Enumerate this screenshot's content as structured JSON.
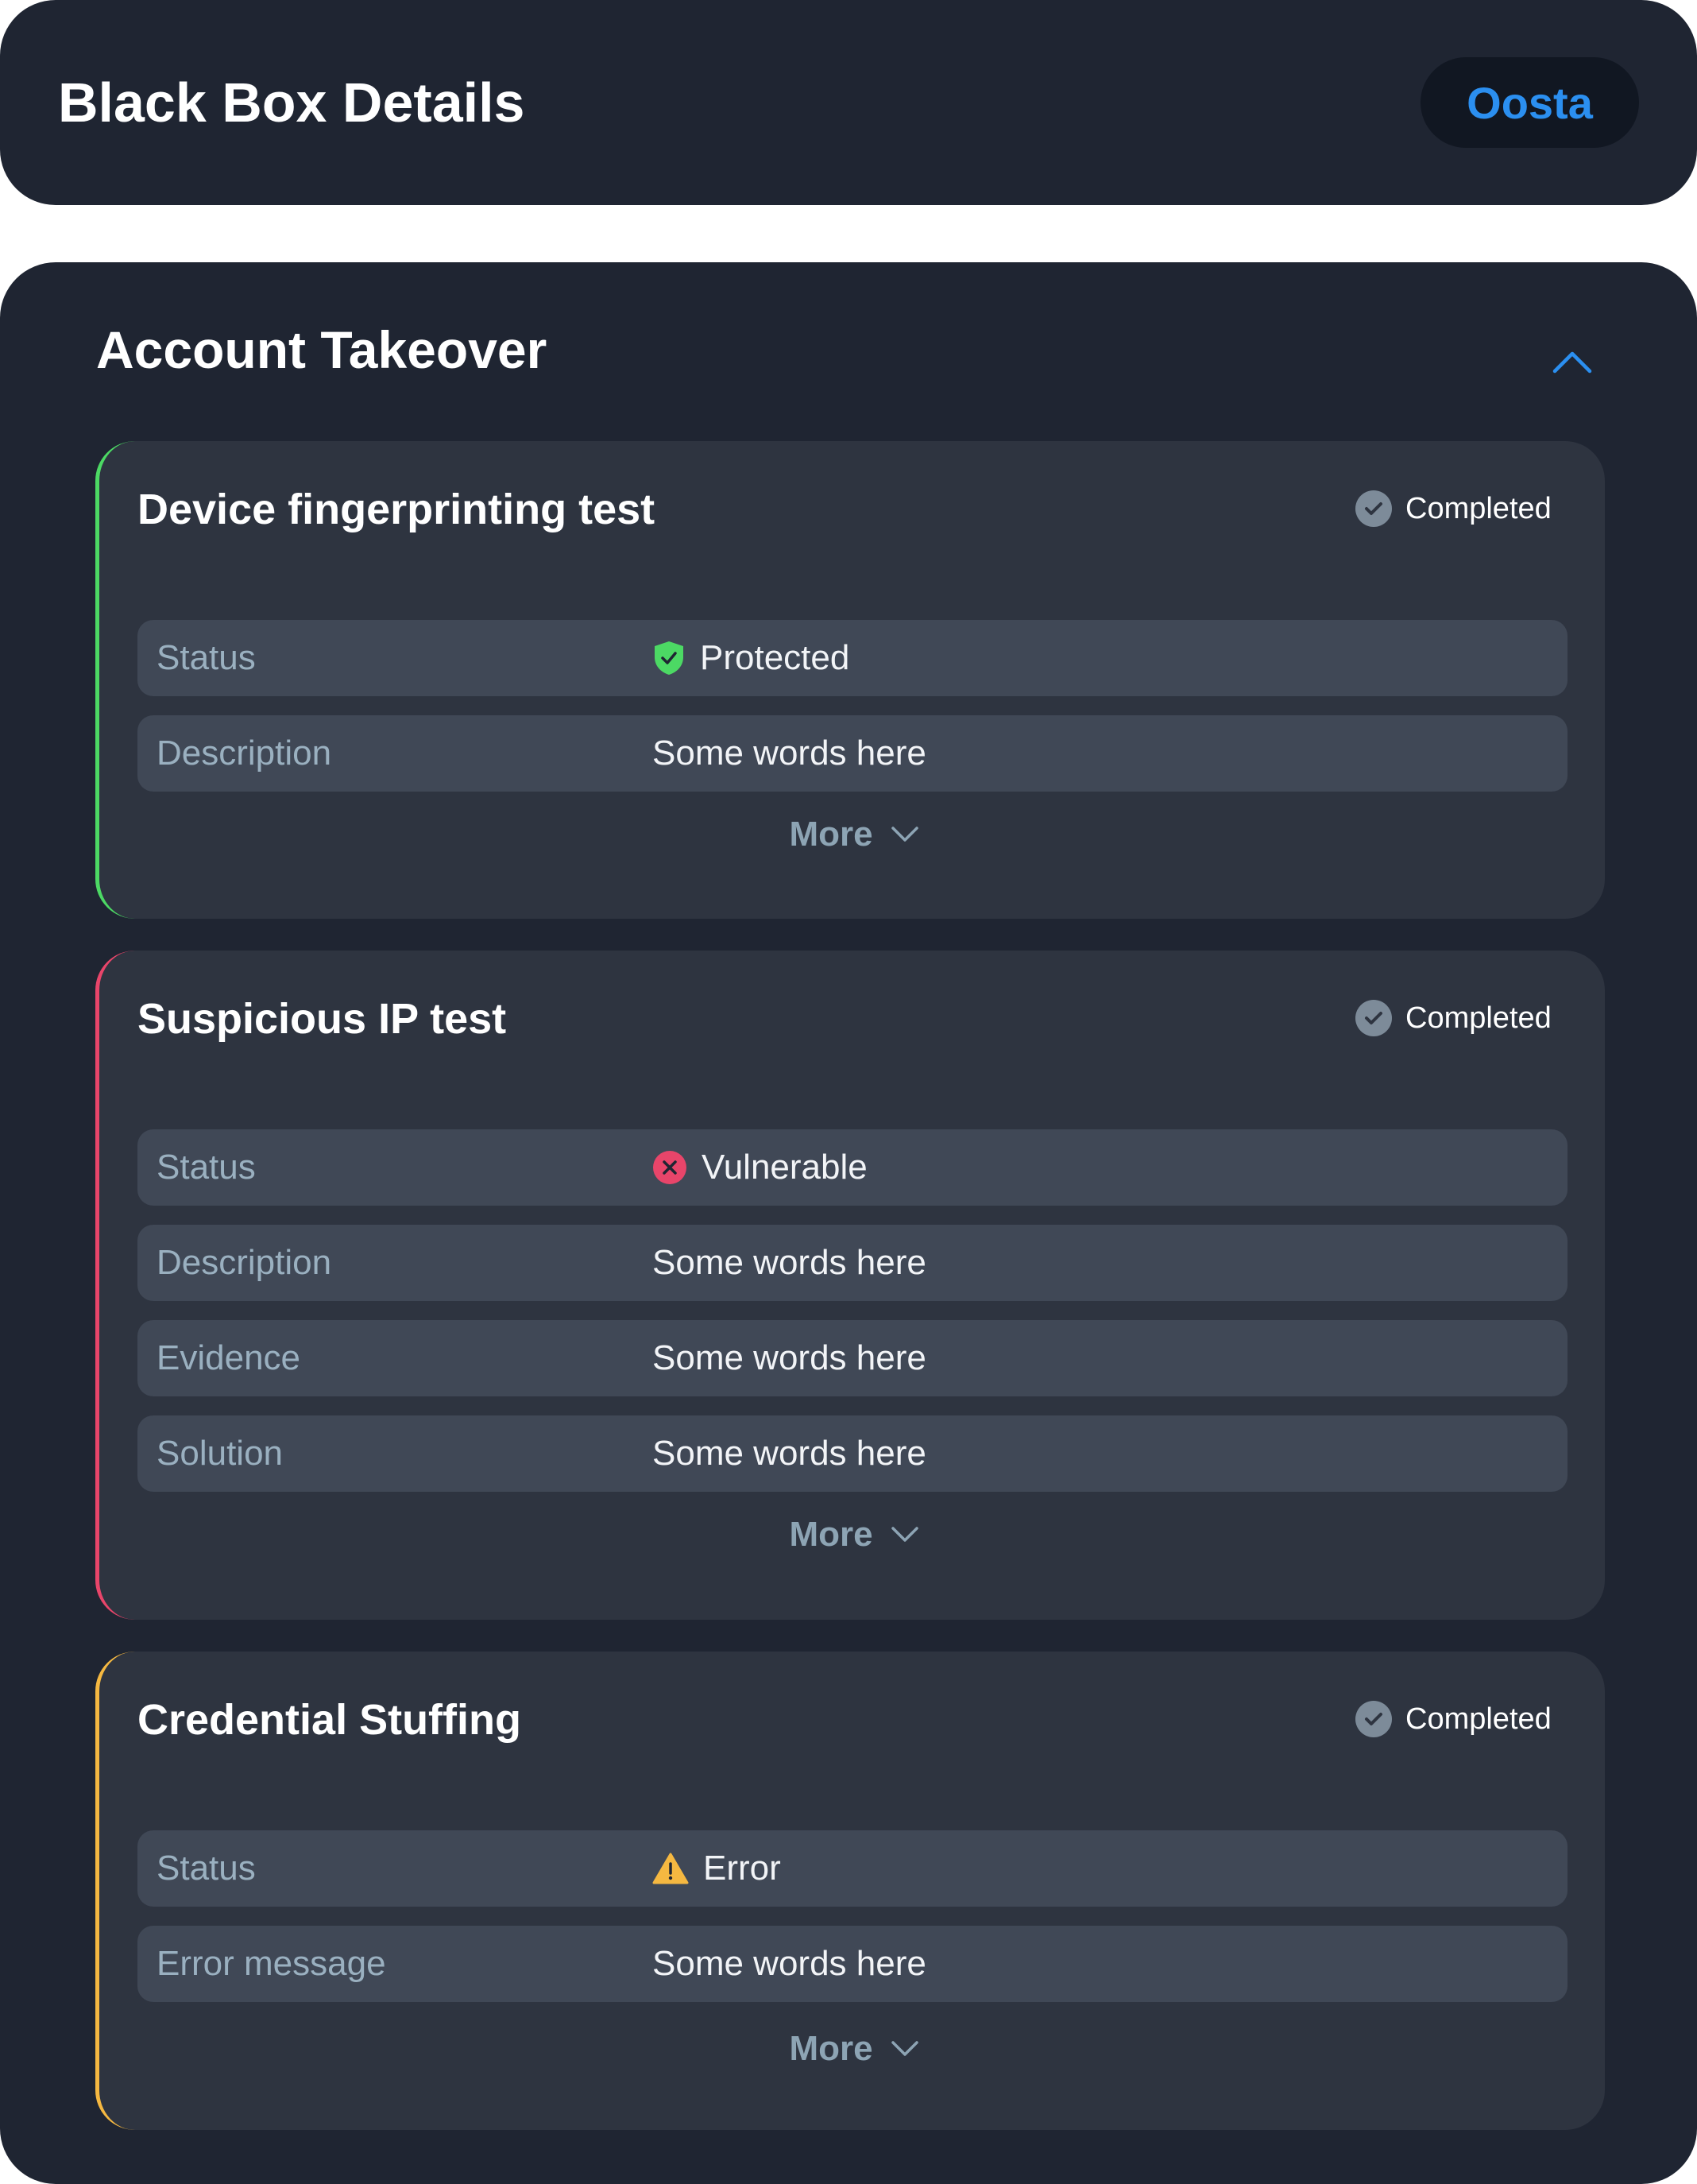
{
  "header": {
    "title": "Black Box Details",
    "button_label": "Oosta"
  },
  "section": {
    "title": "Account Takeover"
  },
  "cards": [
    {
      "title": "Device fingerprinting test",
      "state": "Completed",
      "accent": "#4cd964",
      "rows": [
        {
          "label": "Status",
          "value": "Protected",
          "icon": "shield-check-icon",
          "icon_color": "#4cd964"
        },
        {
          "label": "Description",
          "value": "Some words here"
        }
      ],
      "more_label": "More"
    },
    {
      "title": "Suspicious IP test",
      "state": "Completed",
      "accent": "#e8456a",
      "rows": [
        {
          "label": "Status",
          "value": "Vulnerable",
          "icon": "x-circle-icon",
          "icon_color": "#e8456a"
        },
        {
          "label": "Description",
          "value": "Some words here"
        },
        {
          "label": "Evidence",
          "value": "Some words here"
        },
        {
          "label": "Solution",
          "value": "Some words here"
        }
      ],
      "more_label": "More"
    },
    {
      "title": "Credential Stuffing",
      "state": "Completed",
      "accent": "#f5b841",
      "rows": [
        {
          "label": "Status",
          "value": "Error",
          "icon": "warning-triangle-icon",
          "icon_color": "#f5b841"
        },
        {
          "label": "Error message",
          "value": "Some words here"
        }
      ],
      "more_label": "More"
    }
  ],
  "colors": {
    "accent_blue": "#2b8ff0",
    "background": "#1f2532",
    "card": "#2e3440",
    "row": "#404856"
  }
}
